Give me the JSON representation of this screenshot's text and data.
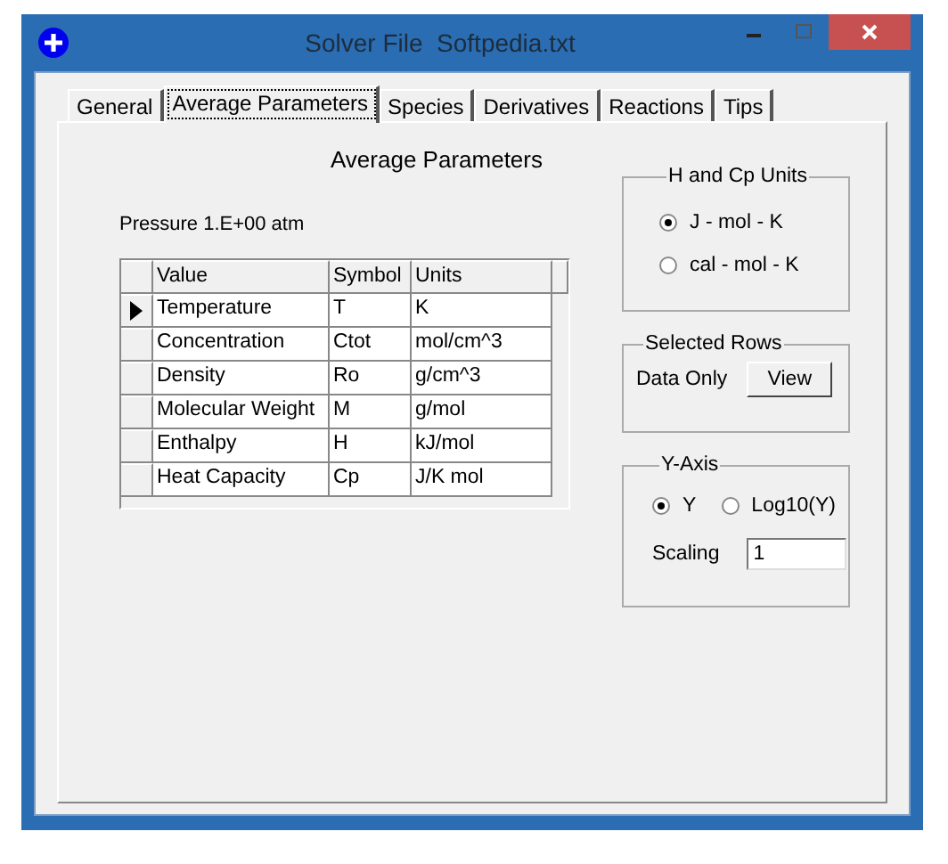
{
  "window": {
    "title": "Solver File  Softpedia.txt"
  },
  "tabs": [
    {
      "label": "General",
      "selected": false
    },
    {
      "label": "Average Parameters",
      "selected": true
    },
    {
      "label": "Species",
      "selected": false
    },
    {
      "label": "Derivatives",
      "selected": false
    },
    {
      "label": "Reactions",
      "selected": false
    },
    {
      "label": "Tips",
      "selected": false
    }
  ],
  "heading": "Average Parameters",
  "pressure": "Pressure 1.E+00 atm",
  "table": {
    "columns": [
      "Value",
      "Symbol",
      "Units"
    ],
    "rows": [
      {
        "cells": [
          "Temperature",
          "T",
          "K"
        ],
        "current": true
      },
      {
        "cells": [
          "Concentration",
          "Ctot",
          "mol/cm^3"
        ],
        "current": false
      },
      {
        "cells": [
          "Density",
          "Ro",
          "g/cm^3"
        ],
        "current": false
      },
      {
        "cells": [
          "Molecular Weight",
          "M",
          "g/mol"
        ],
        "current": false
      },
      {
        "cells": [
          "Enthalpy",
          "H",
          "kJ/mol"
        ],
        "current": false
      },
      {
        "cells": [
          "Heat Capacity",
          "Cp",
          "J/K mol"
        ],
        "current": false
      }
    ]
  },
  "units_group": {
    "title": "H and Cp Units",
    "options": [
      {
        "label": "J - mol - K",
        "selected": true
      },
      {
        "label": "cal - mol - K",
        "selected": false
      }
    ]
  },
  "selected_rows_group": {
    "title": "Selected Rows",
    "label": "Data Only",
    "button": "View"
  },
  "y_axis_group": {
    "title": "Y-Axis",
    "options": [
      {
        "label": "Y",
        "selected": true
      },
      {
        "label": "Log10(Y)",
        "selected": false
      }
    ],
    "scaling_label": "Scaling",
    "scaling_value": "1"
  }
}
